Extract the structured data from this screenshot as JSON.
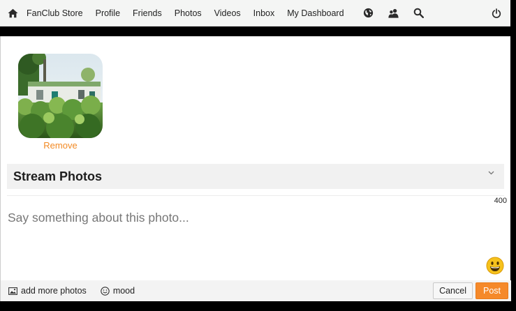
{
  "nav": {
    "links": [
      "FanClub Store",
      "Profile",
      "Friends",
      "Photos",
      "Videos",
      "Inbox",
      "My Dashboard"
    ],
    "icons": [
      "home-icon",
      "globe-icon",
      "people-icon",
      "search-icon",
      "power-icon"
    ]
  },
  "upload": {
    "remove_label": "Remove"
  },
  "stream": {
    "title": "Stream Photos",
    "char_count": "400",
    "placeholder": "Say something about this photo..."
  },
  "footer": {
    "add_more_label": "add more photos",
    "mood_label": "mood",
    "cancel_label": "Cancel",
    "post_label": "Post"
  },
  "colors": {
    "accent": "#f5892a",
    "link": "#f28a24"
  }
}
